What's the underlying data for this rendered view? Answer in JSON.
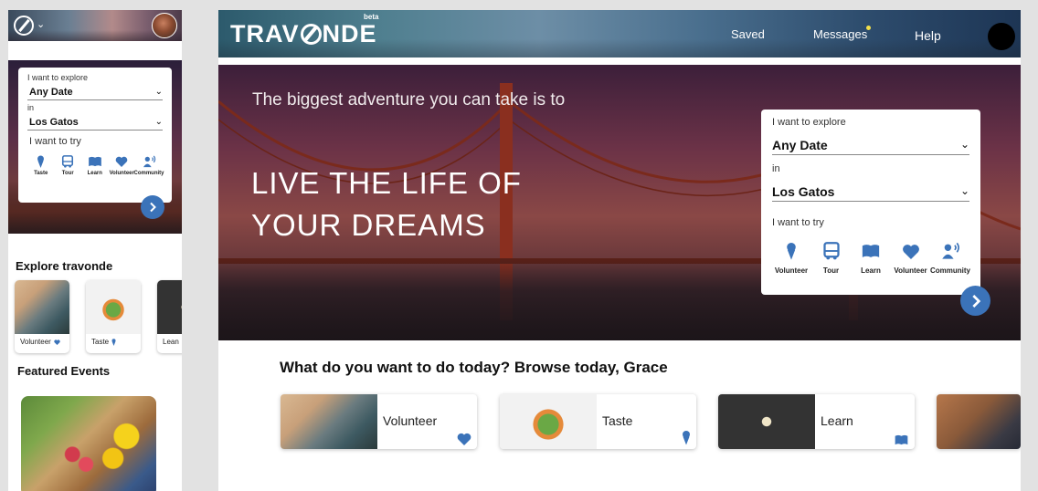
{
  "colors": {
    "accent": "#3b73b9",
    "notification": "#f4e04a"
  },
  "mobile": {
    "search": {
      "explore_label": "I want to explore",
      "date_value": "Any Date",
      "in_label": "in",
      "location_value": "Los Gatos",
      "try_label": "I want to try",
      "categories": [
        {
          "label": "Taste",
          "icon": "ice-cream-icon"
        },
        {
          "label": "Tour",
          "icon": "bus-icon"
        },
        {
          "label": "Learn",
          "icon": "book-icon"
        },
        {
          "label": "Volunteer",
          "icon": "heart-icon"
        },
        {
          "label": "Community",
          "icon": "community-icon"
        }
      ]
    },
    "explore_title": "Explore travonde",
    "explore_tiles": [
      {
        "label": "Volunteer",
        "icon": "heart-icon"
      },
      {
        "label": "Taste",
        "icon": "ice-cream-icon"
      },
      {
        "label": "Lean"
      }
    ],
    "featured_title": "Featured Events"
  },
  "desktop": {
    "logo_text": "TRAV",
    "logo_text_end": "NDE",
    "beta_label": "beta",
    "nav": {
      "saved": "Saved",
      "messages": "Messages",
      "help": "Help"
    },
    "hero": {
      "pre_title": "The biggest adventure you can take is to",
      "title_line1": "LIVE THE LIFE OF",
      "title_line2": "YOUR DREAMS"
    },
    "search": {
      "explore_label": "I want to explore",
      "date_value": "Any Date",
      "in_label": "in",
      "location_value": "Los Gatos",
      "try_label": "I want to try",
      "categories": [
        {
          "label": "Volunteer",
          "icon": "ice-cream-icon"
        },
        {
          "label": "Tour",
          "icon": "bus-icon"
        },
        {
          "label": "Learn",
          "icon": "book-icon"
        },
        {
          "label": "Volunteer",
          "icon": "heart-icon"
        },
        {
          "label": "Community",
          "icon": "community-icon"
        }
      ]
    },
    "browse_title": "What do you want to do today? Browse today, Grace",
    "browse_tiles": [
      {
        "label": "Volunteer",
        "icon": "heart-icon"
      },
      {
        "label": "Taste",
        "icon": "ice-cream-icon"
      },
      {
        "label": "Learn",
        "icon": "book-icon"
      }
    ]
  }
}
